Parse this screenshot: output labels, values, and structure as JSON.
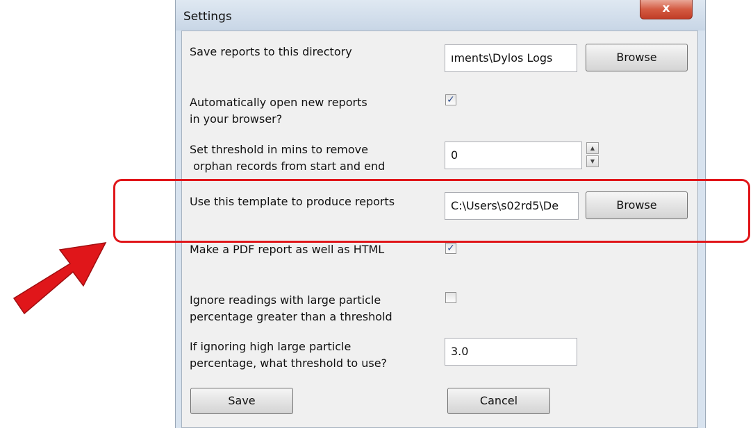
{
  "window": {
    "title": "Settings",
    "close_glyph": "x"
  },
  "settings": {
    "save_dir": {
      "label": "Save reports to this directory",
      "value": "ıments\\Dylos Logs",
      "browse": "Browse"
    },
    "auto_open": {
      "label_line1": "Automatically open new reports",
      "label_line2": "in your browser?",
      "checked": true
    },
    "threshold_mins": {
      "label_line1": "Set threshold in mins to remove",
      "label_line2": " orphan records from start and end",
      "value": "0"
    },
    "template": {
      "label": "Use this template to produce reports",
      "value": "C:\\Users\\s02rd5\\De",
      "browse": "Browse"
    },
    "pdf_report": {
      "label": "Make a PDF report as well as HTML",
      "checked": true
    },
    "ignore_large": {
      "label_line1": "Ignore readings with large particle",
      "label_line2": "percentage greater than a threshold",
      "checked": false
    },
    "large_threshold": {
      "label_line1": "If ignoring high large particle",
      "label_line2": "percentage, what threshold to use?",
      "value": "3.0"
    }
  },
  "buttons": {
    "save": "Save",
    "cancel": "Cancel"
  },
  "annotation": {
    "color": "#e0161a"
  },
  "icons": {
    "check": "✓",
    "spin_up": "▲",
    "spin_down": "▼"
  }
}
